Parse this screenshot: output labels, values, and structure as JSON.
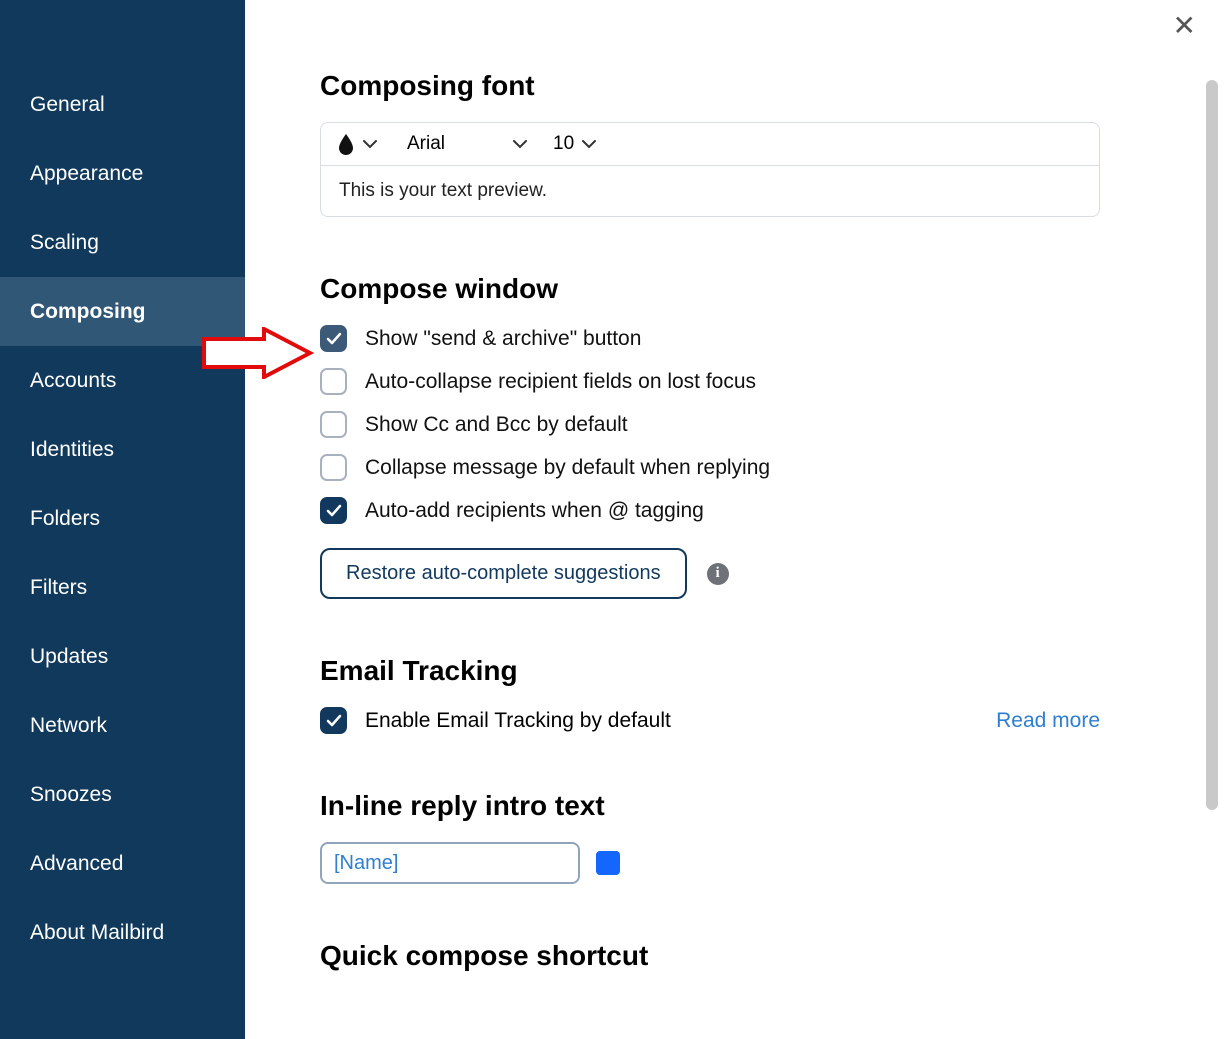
{
  "sidebar": {
    "items": [
      {
        "label": "General"
      },
      {
        "label": "Appearance"
      },
      {
        "label": "Scaling"
      },
      {
        "label": "Composing",
        "active": true
      },
      {
        "label": "Accounts"
      },
      {
        "label": "Identities"
      },
      {
        "label": "Folders"
      },
      {
        "label": "Filters"
      },
      {
        "label": "Updates"
      },
      {
        "label": "Network"
      },
      {
        "label": "Snoozes"
      },
      {
        "label": "Advanced"
      },
      {
        "label": "About Mailbird"
      }
    ]
  },
  "sections": {
    "font": {
      "title": "Composing font",
      "font_name": "Arial",
      "font_size": "10",
      "preview": "This is your text preview."
    },
    "compose_window": {
      "title": "Compose window",
      "options": [
        {
          "label": "Show \"send & archive\" button",
          "checked": true
        },
        {
          "label": "Auto-collapse recipient fields on lost focus",
          "checked": false
        },
        {
          "label": "Show Cc and Bcc by default",
          "checked": false
        },
        {
          "label": "Collapse message by default when replying",
          "checked": false
        },
        {
          "label": "Auto-add recipients when @ tagging",
          "checked": true
        }
      ],
      "restore_btn": "Restore auto-complete suggestions"
    },
    "tracking": {
      "title": "Email Tracking",
      "option_label": "Enable Email Tracking by default",
      "option_checked": true,
      "read_more": "Read more"
    },
    "inline_reply": {
      "title": "In-line reply intro text",
      "value": "[Name]"
    },
    "quick": {
      "title": "Quick compose shortcut"
    }
  },
  "info_glyph": "i"
}
